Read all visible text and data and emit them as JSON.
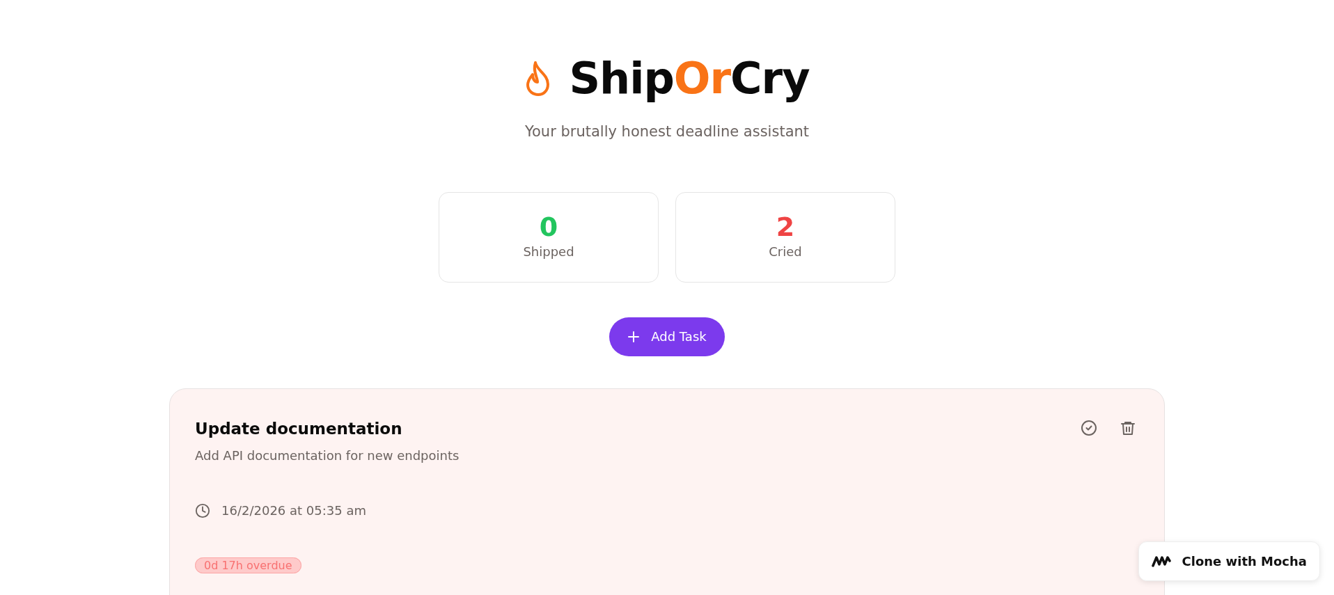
{
  "header": {
    "title": [
      {
        "text": "Ship",
        "accent": false
      },
      {
        "text": "Or",
        "accent": true
      },
      {
        "text": "Cry",
        "accent": false
      }
    ],
    "subtitle": "Your brutally honest deadline assistant"
  },
  "stats": [
    {
      "value": "0",
      "label": "Shipped",
      "color": "#22c55e"
    },
    {
      "value": "2",
      "label": "Cried",
      "color": "#ef4444"
    }
  ],
  "add_button": "Add Task",
  "tasks": [
    {
      "title": "Update documentation",
      "description": "Add API documentation for new endpoints",
      "deadline": "16/2/2026 at 05:35 am",
      "badge": "0d 17h overdue",
      "overdue": true
    }
  ],
  "clone_button": "Clone with Mocha"
}
